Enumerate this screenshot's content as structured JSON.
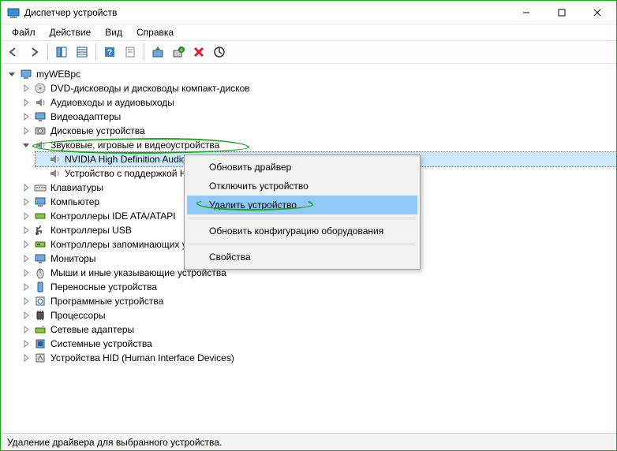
{
  "window": {
    "title": "Диспетчер устройств"
  },
  "menu": {
    "file": "Файл",
    "action": "Действие",
    "view": "Вид",
    "help": "Справка"
  },
  "tree": {
    "root": "myWEBpc",
    "nodes": [
      {
        "label": "DVD-дисководы и дисководы компакт-дисков"
      },
      {
        "label": "Аудиовходы и аудиовыходы"
      },
      {
        "label": "Видеоадаптеры"
      },
      {
        "label": "Дисковые устройства"
      },
      {
        "label": "Звуковые, игровые и видеоустройства",
        "expanded": true,
        "children": [
          {
            "label": "NVIDIA High Definition Audio",
            "selected": true
          },
          {
            "label": "Устройство с поддержкой High Definition Audio"
          }
        ]
      },
      {
        "label": "Клавиатуры"
      },
      {
        "label": "Компьютер"
      },
      {
        "label": "Контроллеры IDE ATA/ATAPI"
      },
      {
        "label": "Контроллеры USB"
      },
      {
        "label": "Контроллеры запоминающих устройств"
      },
      {
        "label": "Мониторы"
      },
      {
        "label": "Мыши и иные указывающие устройства"
      },
      {
        "label": "Переносные устройства"
      },
      {
        "label": "Программные устройства"
      },
      {
        "label": "Процессоры"
      },
      {
        "label": "Сетевые адаптеры"
      },
      {
        "label": "Системные устройства"
      },
      {
        "label": "Устройства HID (Human Interface Devices)"
      }
    ]
  },
  "context_menu": {
    "update_driver": "Обновить драйвер",
    "disable_device": "Отключить устройство",
    "uninstall_device": "Удалить устройство",
    "scan_hardware": "Обновить конфигурацию оборудования",
    "properties": "Свойства"
  },
  "status": {
    "text": "Удаление драйвера для выбранного устройства."
  },
  "icons": {
    "categories": [
      "disc",
      "speaker",
      "monitor",
      "disk",
      "speaker",
      "keyboard",
      "computer",
      "ide",
      "usb",
      "storage",
      "monitor",
      "mouse",
      "portable",
      "software",
      "cpu",
      "network",
      "system",
      "hid"
    ]
  }
}
